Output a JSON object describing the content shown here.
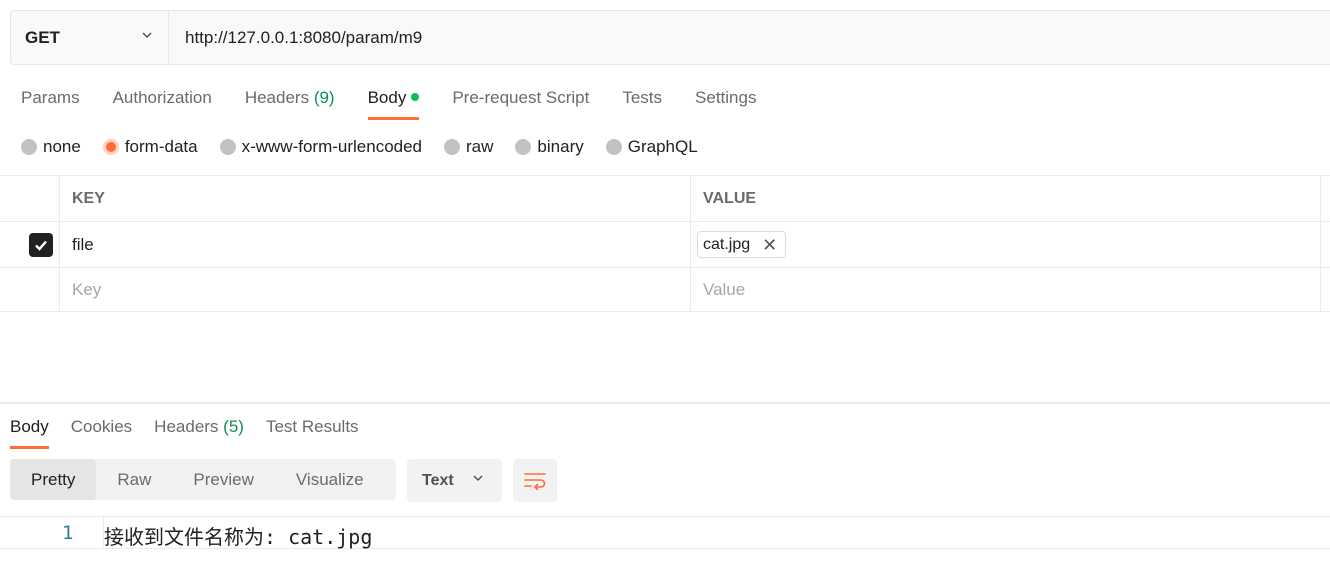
{
  "request": {
    "method": "GET",
    "url": "http://127.0.0.1:8080/param/m9"
  },
  "request_tabs": [
    {
      "label": "Params"
    },
    {
      "label": "Authorization"
    },
    {
      "label": "Headers",
      "count": "(9)"
    },
    {
      "label": "Body",
      "active": true
    },
    {
      "label": "Pre-request Script"
    },
    {
      "label": "Tests"
    },
    {
      "label": "Settings"
    }
  ],
  "body_types": [
    {
      "label": "none"
    },
    {
      "label": "form-data",
      "selected": true
    },
    {
      "label": "x-www-form-urlencoded"
    },
    {
      "label": "raw"
    },
    {
      "label": "binary"
    },
    {
      "label": "GraphQL"
    }
  ],
  "params_table": {
    "headers": {
      "key": "KEY",
      "value": "VALUE"
    },
    "rows": [
      {
        "checked": true,
        "key": "file",
        "value_chip": "cat.jpg"
      }
    ],
    "new_row": {
      "key_placeholder": "Key",
      "value_placeholder": "Value"
    }
  },
  "response_tabs": [
    {
      "label": "Body",
      "active": true
    },
    {
      "label": "Cookies"
    },
    {
      "label": "Headers",
      "count": "(5)"
    },
    {
      "label": "Test Results"
    }
  ],
  "view_modes": [
    "Pretty",
    "Raw",
    "Preview",
    "Visualize"
  ],
  "active_view_mode": "Pretty",
  "format_select": "Text",
  "response_body": {
    "line_number": "1",
    "text": "接收到文件名称为: cat.jpg"
  },
  "colors": {
    "accent": "#ff6c37",
    "count_green": "#0f8f55",
    "dot_green": "#0cbb52"
  }
}
